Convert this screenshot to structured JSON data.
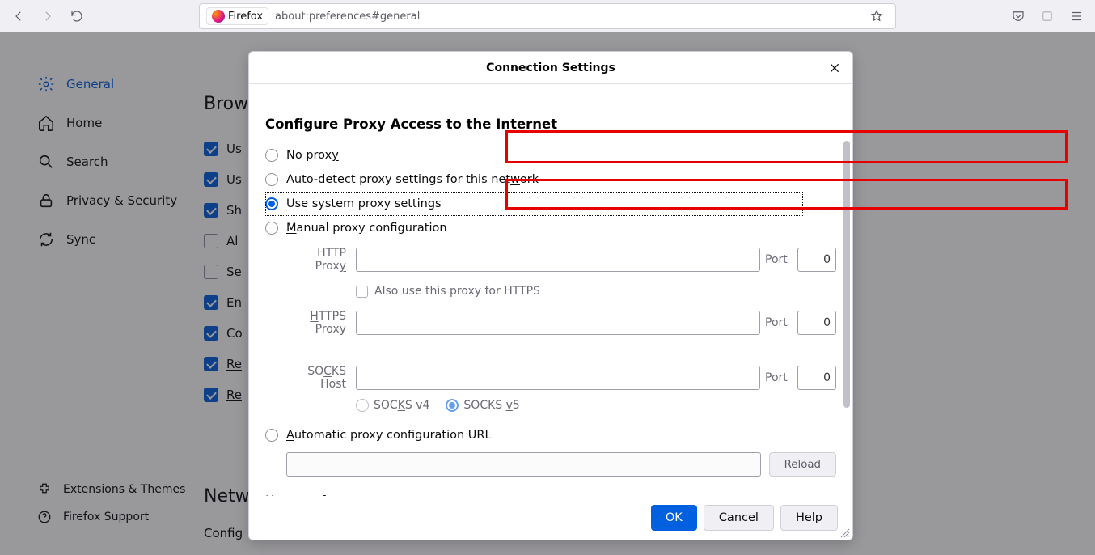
{
  "toolbar": {
    "firefox_label": "Firefox",
    "url": "about:preferences#general"
  },
  "sidebar": {
    "items": [
      {
        "label": "General"
      },
      {
        "label": "Home"
      },
      {
        "label": "Search"
      },
      {
        "label": "Privacy & Security"
      },
      {
        "label": "Sync"
      }
    ],
    "bottom": [
      {
        "label": "Extensions & Themes"
      },
      {
        "label": "Firefox Support"
      }
    ]
  },
  "background": {
    "browsing_header": "Brow",
    "chk_use": "Us",
    "chk_use2": "Us",
    "chk_sh": "Sh",
    "chk_al": "Al",
    "chk_se": "Se",
    "chk_en": "En",
    "chk_co": "Co",
    "chk_re": "Re",
    "chk_re2": "Re",
    "network_header": "Netw",
    "network_sub": "Config"
  },
  "modal": {
    "title": "Connection Settings",
    "section_title": "Configure Proxy Access to the Internet",
    "radios": {
      "no_proxy": "No proxy",
      "auto_detect": "Auto-detect proxy settings for this network",
      "system": "Use system proxy settings",
      "manual": "Manual proxy configuration",
      "auto_url": "Automatic proxy configuration URL"
    },
    "labels": {
      "http": "HTTP Proxy",
      "https": "HTTPS Proxy",
      "socks": "SOCKS Host",
      "port": "Port",
      "also_https": "Also use this proxy for HTTPS",
      "socks4": "SOCKS v4",
      "socks5": "SOCKS v5",
      "reload": "Reload",
      "no_proxy_for": "No proxy for"
    },
    "values": {
      "http_host": "",
      "http_port": "0",
      "https_host": "",
      "https_port": "0",
      "socks_host": "",
      "socks_port": "0",
      "auto_url": ""
    },
    "buttons": {
      "ok": "OK",
      "cancel": "Cancel",
      "help": "Help"
    }
  }
}
